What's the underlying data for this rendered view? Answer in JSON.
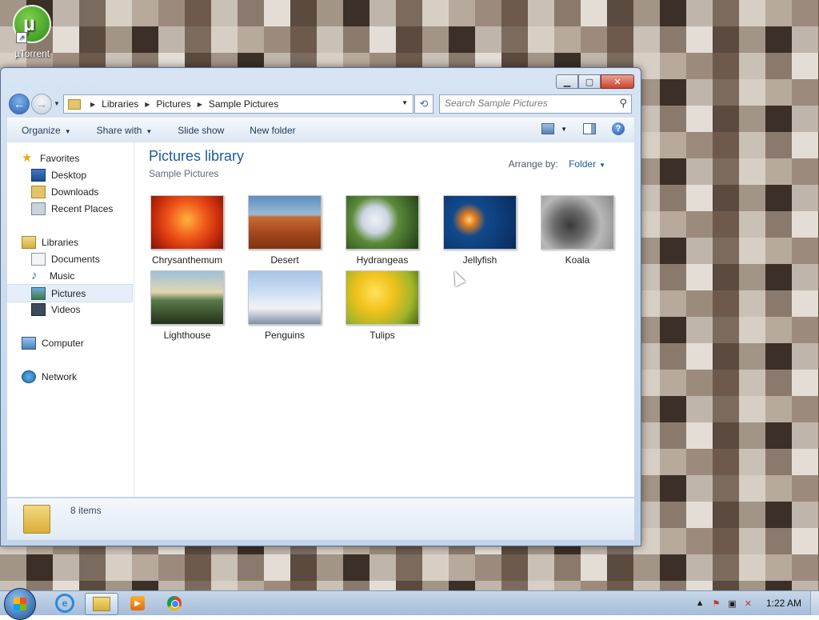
{
  "desktop": {
    "icons": [
      {
        "label": "µTorrent"
      }
    ]
  },
  "window": {
    "address": {
      "breadcrumb": [
        "Libraries",
        "Pictures",
        "Sample Pictures"
      ]
    },
    "search": {
      "placeholder": "Search Sample Pictures"
    },
    "toolbar": {
      "organize": "Organize",
      "share_with": "Share with",
      "slide_show": "Slide show",
      "new_folder": "New folder",
      "help": "?"
    },
    "nav_pane": {
      "favorites": {
        "label": "Favorites",
        "items": [
          "Desktop",
          "Downloads",
          "Recent Places"
        ]
      },
      "libraries": {
        "label": "Libraries",
        "items": [
          "Documents",
          "Music",
          "Pictures",
          "Videos"
        ],
        "selected": "Pictures"
      },
      "computer": "Computer",
      "network": "Network"
    },
    "content": {
      "title": "Pictures library",
      "subtitle": "Sample Pictures",
      "arrange_label": "Arrange by:",
      "arrange_value": "Folder",
      "items": [
        "Chrysanthemum",
        "Desert",
        "Hydrangeas",
        "Jellyfish",
        "Koala",
        "Lighthouse",
        "Penguins",
        "Tulips"
      ]
    },
    "details": {
      "count": "8 items"
    }
  },
  "taskbar": {
    "clock": "1:22 AM"
  },
  "colors": {
    "accent": "#1e5aa0",
    "selection": "#e5eef9"
  }
}
